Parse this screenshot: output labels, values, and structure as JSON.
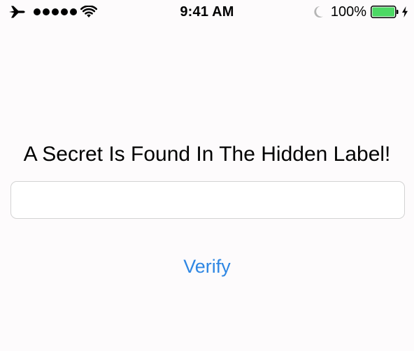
{
  "status_bar": {
    "time": "9:41 AM",
    "battery_percent": "100%",
    "battery_level": 1.0,
    "signal_bars": 5,
    "icons": {
      "left": [
        "airplane-icon",
        "signal-dots",
        "wifi-icon"
      ],
      "right": [
        "moon-icon",
        "battery-icon",
        "charging-bolt-icon"
      ]
    },
    "colors": {
      "battery_fill": "#4cd964",
      "moon": "#b5b5b5"
    }
  },
  "main": {
    "label": "A Secret Is Found In The Hidden Label!",
    "input": {
      "value": "",
      "placeholder": ""
    },
    "verify_label": "Verify"
  },
  "colors": {
    "accent": "#2f87e3",
    "background": "#fdfbfc",
    "field_border": "#d3d3d3"
  }
}
